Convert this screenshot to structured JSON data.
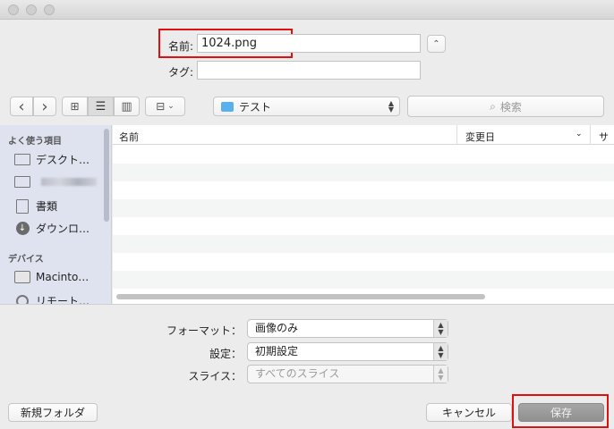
{
  "save_as": {
    "label": "名前:",
    "value": "1024.png"
  },
  "tags": {
    "label": "タグ:",
    "value": ""
  },
  "toolbar": {
    "back": "‹",
    "forward": "›",
    "view_icon": "⊞",
    "view_list": "☰",
    "view_column": "▥",
    "view_gallery": "⊟",
    "location": "テスト",
    "search_placeholder": "検索"
  },
  "sidebar": {
    "favorites_header": "よく使う項目",
    "favorites": [
      {
        "label": "デスクト…",
        "icon": "desktop-icon"
      },
      {
        "label": "",
        "icon": "folder-icon"
      },
      {
        "label": "書類",
        "icon": "documents-icon"
      },
      {
        "label": "ダウンロ…",
        "icon": "download-icon"
      }
    ],
    "devices_header": "デバイス",
    "devices": [
      {
        "label": "Macinto…",
        "icon": "harddisk-icon"
      },
      {
        "label": "リモート…",
        "icon": "disc-icon"
      }
    ]
  },
  "columns": {
    "name": "名前",
    "date_modified": "変更日",
    "size": "サ"
  },
  "options": {
    "format_label": "フォーマット：",
    "format_value": "画像のみ",
    "settings_label": "設定：",
    "settings_value": "初期設定",
    "slices_label": "スライス：",
    "slices_value": "すべてのスライス"
  },
  "buttons": {
    "new_folder": "新規フォルダ",
    "cancel": "キャンセル",
    "save": "保存"
  }
}
